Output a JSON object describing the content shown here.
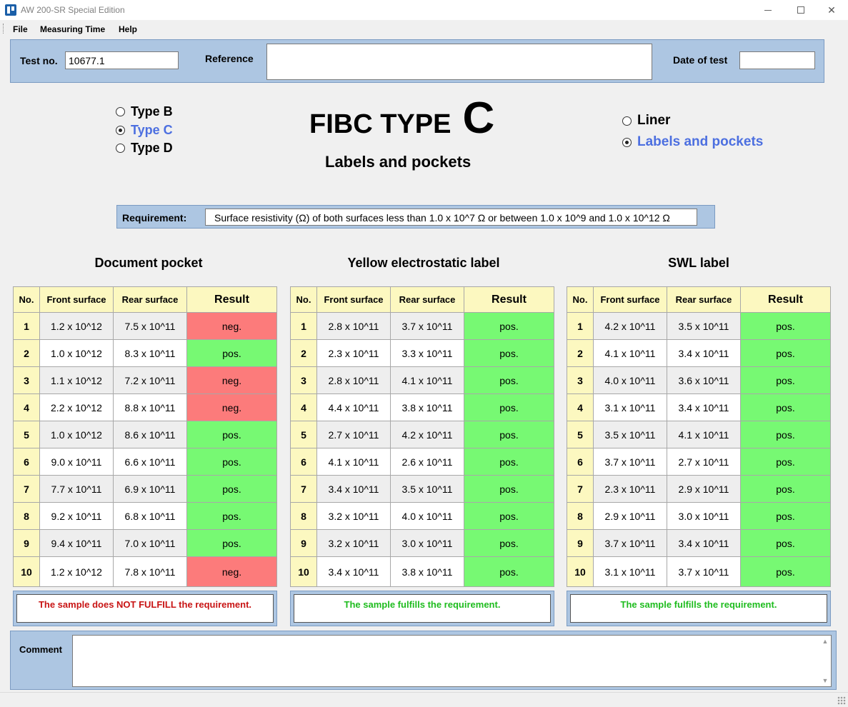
{
  "window": {
    "title": "AW 200-SR Special Edition"
  },
  "menu": [
    "File",
    "Measuring Time",
    "Help"
  ],
  "header": {
    "test_no_label": "Test no.",
    "test_no_value": "10677.1",
    "reference_label": "Reference",
    "reference_value": "",
    "date_label": "Date of test",
    "date_value": ""
  },
  "types": [
    {
      "label": "Type B",
      "checked": false
    },
    {
      "label": "Type C",
      "checked": true
    },
    {
      "label": "Type D",
      "checked": false
    }
  ],
  "title": {
    "prefix": "FIBC TYPE",
    "type": "C",
    "subtitle": "Labels and pockets"
  },
  "options": [
    {
      "label": "Liner",
      "checked": false
    },
    {
      "label": "Labels and pockets",
      "checked": true
    }
  ],
  "requirement": {
    "label": "Requirement:",
    "text": "Surface resistivity (Ω) of both surfaces less than 1.0 x 10^7 Ω or between 1.0 x 10^9 and 1.0 x 10^12 Ω"
  },
  "table_headers": {
    "no": "No.",
    "front": "Front surface",
    "rear": "Rear surface",
    "result": "Result"
  },
  "tables": [
    {
      "title": "Document pocket",
      "verdict": "The sample does NOT FULFILL the requirement.",
      "verdict_ok": false,
      "rows": [
        {
          "no": "1",
          "front": "1.2 x 10^12",
          "rear": "7.5 x 10^11",
          "result": "neg."
        },
        {
          "no": "2",
          "front": "1.0 x 10^12",
          "rear": "8.3 x 10^11",
          "result": "pos."
        },
        {
          "no": "3",
          "front": "1.1 x 10^12",
          "rear": "7.2 x 10^11",
          "result": "neg."
        },
        {
          "no": "4",
          "front": "2.2 x 10^12",
          "rear": "8.8 x 10^11",
          "result": "neg."
        },
        {
          "no": "5",
          "front": "1.0 x 10^12",
          "rear": "8.6 x 10^11",
          "result": "pos."
        },
        {
          "no": "6",
          "front": "9.0 x 10^11",
          "rear": "6.6 x 10^11",
          "result": "pos."
        },
        {
          "no": "7",
          "front": "7.7 x 10^11",
          "rear": "6.9 x 10^11",
          "result": "pos."
        },
        {
          "no": "8",
          "front": "9.2 x 10^11",
          "rear": "6.8 x 10^11",
          "result": "pos."
        },
        {
          "no": "9",
          "front": "9.4 x 10^11",
          "rear": "7.0 x 10^11",
          "result": "pos."
        },
        {
          "no": "10",
          "front": "1.2 x 10^12",
          "rear": "7.8 x 10^11",
          "result": "neg."
        }
      ]
    },
    {
      "title": "Yellow electrostatic label",
      "verdict": "The sample fulfills the requirement.",
      "verdict_ok": true,
      "rows": [
        {
          "no": "1",
          "front": "2.8 x 10^11",
          "rear": "3.7 x 10^11",
          "result": "pos."
        },
        {
          "no": "2",
          "front": "2.3 x 10^11",
          "rear": "3.3 x 10^11",
          "result": "pos."
        },
        {
          "no": "3",
          "front": "2.8 x 10^11",
          "rear": "4.1 x 10^11",
          "result": "pos."
        },
        {
          "no": "4",
          "front": "4.4 x 10^11",
          "rear": "3.8 x 10^11",
          "result": "pos."
        },
        {
          "no": "5",
          "front": "2.7 x 10^11",
          "rear": "4.2 x 10^11",
          "result": "pos."
        },
        {
          "no": "6",
          "front": "4.1 x 10^11",
          "rear": "2.6 x 10^11",
          "result": "pos."
        },
        {
          "no": "7",
          "front": "3.4 x 10^11",
          "rear": "3.5 x 10^11",
          "result": "pos."
        },
        {
          "no": "8",
          "front": "3.2 x 10^11",
          "rear": "4.0 x 10^11",
          "result": "pos."
        },
        {
          "no": "9",
          "front": "3.2 x 10^11",
          "rear": "3.0 x 10^11",
          "result": "pos."
        },
        {
          "no": "10",
          "front": "3.4 x 10^11",
          "rear": "3.8 x 10^11",
          "result": "pos."
        }
      ]
    },
    {
      "title": "SWL label",
      "verdict": "The sample fulfills the requirement.",
      "verdict_ok": true,
      "rows": [
        {
          "no": "1",
          "front": "4.2 x 10^11",
          "rear": "3.5 x 10^11",
          "result": "pos."
        },
        {
          "no": "2",
          "front": "4.1 x 10^11",
          "rear": "3.4 x 10^11",
          "result": "pos."
        },
        {
          "no": "3",
          "front": "4.0 x 10^11",
          "rear": "3.6 x 10^11",
          "result": "pos."
        },
        {
          "no": "4",
          "front": "3.1 x 10^11",
          "rear": "3.4 x 10^11",
          "result": "pos."
        },
        {
          "no": "5",
          "front": "3.5 x 10^11",
          "rear": "4.1 x 10^11",
          "result": "pos."
        },
        {
          "no": "6",
          "front": "3.7 x 10^11",
          "rear": "2.7 x 10^11",
          "result": "pos."
        },
        {
          "no": "7",
          "front": "2.3 x 10^11",
          "rear": "2.9 x 10^11",
          "result": "pos."
        },
        {
          "no": "8",
          "front": "2.9 x 10^11",
          "rear": "3.0 x 10^11",
          "result": "pos."
        },
        {
          "no": "9",
          "front": "3.7 x 10^11",
          "rear": "3.4 x 10^11",
          "result": "pos."
        },
        {
          "no": "10",
          "front": "3.1 x 10^11",
          "rear": "3.7 x 10^11",
          "result": "pos."
        }
      ]
    }
  ],
  "comment": {
    "label": "Comment",
    "value": ""
  },
  "colors": {
    "panel": "#adc6e2",
    "header_cell": "#fcf8c0",
    "pos": "#77f973",
    "neg": "#fc7b7b",
    "selected": "#4c6fe0"
  }
}
